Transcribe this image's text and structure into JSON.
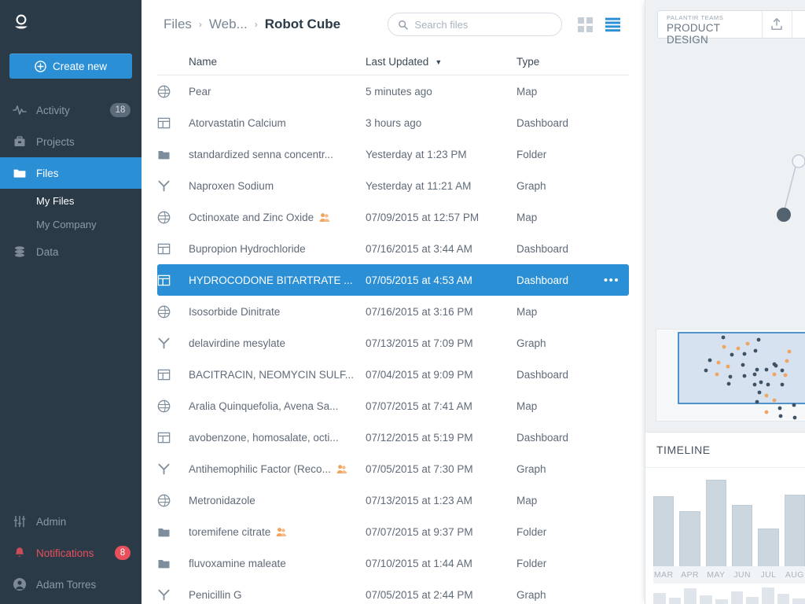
{
  "sidebar": {
    "logo_icon": "palantir-logo-icon",
    "create_button": {
      "label": "Create new",
      "icon": "plus-circle-icon"
    },
    "items": [
      {
        "label": "Activity",
        "icon": "activity-pulse-icon",
        "badge": "18",
        "active": false
      },
      {
        "label": "Projects",
        "icon": "briefcase-icon",
        "badge": "",
        "active": false
      },
      {
        "label": "Files",
        "icon": "folder-icon",
        "badge": "",
        "active": true
      }
    ],
    "sub_items": [
      {
        "label": "My Files",
        "current": true
      },
      {
        "label": "My Company",
        "current": false
      }
    ],
    "data_item": {
      "label": "Data",
      "icon": "database-icon"
    },
    "bottom_items": [
      {
        "label": "Admin",
        "icon": "sliders-icon",
        "badge": "",
        "alert": false
      },
      {
        "label": "Notifications",
        "icon": "bell-icon",
        "badge": "8",
        "alert": true
      },
      {
        "label": "Adam Torres",
        "icon": "user-avatar-icon",
        "badge": "",
        "alert": false
      }
    ],
    "colors": {
      "background": "#2b3a47",
      "accent": "#2a8fd4",
      "alert": "#e8505b"
    }
  },
  "header": {
    "breadcrumbs": [
      {
        "label": "Files",
        "current": false
      },
      {
        "label": "Web...",
        "current": false
      },
      {
        "label": "Robot Cube",
        "current": true
      }
    ],
    "separator": "›",
    "search": {
      "placeholder": "Search files",
      "value": "",
      "icon": "search-icon"
    },
    "view_grid": {
      "icon": "grid-view-icon",
      "active": false
    },
    "view_list": {
      "icon": "list-view-icon",
      "active": true
    }
  },
  "table": {
    "columns": {
      "name": "Name",
      "last_updated": "Last Updated",
      "type": "Type"
    },
    "sort": {
      "column": "Last Updated",
      "caret": "▼"
    },
    "more_label": "•••",
    "rows": [
      {
        "icon": "map-globe-icon",
        "name": "Pear",
        "updated": "5 minutes ago",
        "type": "Map",
        "shared": false,
        "selected": false
      },
      {
        "icon": "dashboard-icon",
        "name": "Atorvastatin Calcium",
        "updated": "3 hours ago",
        "type": "Dashboard",
        "shared": false,
        "selected": false
      },
      {
        "icon": "folder-file-icon",
        "name": "standardized senna concentr...",
        "updated": "Yesterday at 1:23 PM",
        "type": "Folder",
        "shared": false,
        "selected": false
      },
      {
        "icon": "graph-icon",
        "name": "Naproxen Sodium",
        "updated": "Yesterday at 11:21 AM",
        "type": "Graph",
        "shared": false,
        "selected": false
      },
      {
        "icon": "map-globe-icon",
        "name": "Octinoxate and Zinc Oxide",
        "updated": "07/09/2015 at 12:57 PM",
        "type": "Map",
        "shared": true,
        "selected": false
      },
      {
        "icon": "dashboard-icon",
        "name": "Bupropion Hydrochloride",
        "updated": "07/16/2015 at 3:44 AM",
        "type": "Dashboard",
        "shared": false,
        "selected": false
      },
      {
        "icon": "dashboard-icon",
        "name": "HYDROCODONE BITARTRATE ...",
        "updated": "07/05/2015 at 4:53 AM",
        "type": "Dashboard",
        "shared": false,
        "selected": true
      },
      {
        "icon": "map-globe-icon",
        "name": "Isosorbide Dinitrate",
        "updated": "07/16/2015 at 3:16 PM",
        "type": "Map",
        "shared": false,
        "selected": false
      },
      {
        "icon": "graph-icon",
        "name": "delavirdine mesylate",
        "updated": "07/13/2015 at 7:09 PM",
        "type": "Graph",
        "shared": false,
        "selected": false
      },
      {
        "icon": "dashboard-icon",
        "name": "BACITRACIN, NEOMYCIN SULF...",
        "updated": "07/04/2015 at 9:09 PM",
        "type": "Dashboard",
        "shared": false,
        "selected": false
      },
      {
        "icon": "map-globe-icon",
        "name": "Aralia Quinquefolia, Avena Sa...",
        "updated": "07/07/2015 at 7:41 AM",
        "type": "Map",
        "shared": false,
        "selected": false
      },
      {
        "icon": "dashboard-icon",
        "name": "avobenzone, homosalate, octi...",
        "updated": "07/12/2015 at 5:19 PM",
        "type": "Dashboard",
        "shared": false,
        "selected": false
      },
      {
        "icon": "graph-icon",
        "name": "Antihemophilic Factor (Reco...",
        "updated": "07/05/2015 at 7:30 PM",
        "type": "Graph",
        "shared": true,
        "selected": false
      },
      {
        "icon": "map-globe-icon",
        "name": "Metronidazole",
        "updated": "07/13/2015 at 1:23 AM",
        "type": "Map",
        "shared": false,
        "selected": false
      },
      {
        "icon": "folder-file-icon",
        "name": "toremifene citrate",
        "updated": "07/07/2015 at 9:37 PM",
        "type": "Folder",
        "shared": true,
        "selected": false
      },
      {
        "icon": "folder-file-icon",
        "name": "fluvoxamine maleate",
        "updated": "07/10/2015 at 1:44 AM",
        "type": "Folder",
        "shared": false,
        "selected": false
      },
      {
        "icon": "graph-icon",
        "name": "Penicillin G",
        "updated": "07/05/2015 at 2:44 PM",
        "type": "Graph",
        "shared": false,
        "selected": false
      }
    ]
  },
  "right_panel": {
    "brand_line1": "PALANTIR TEAMS",
    "brand_line2": "PRODUCT DESIGN",
    "upload_icon": "upload-icon",
    "share_icon": "share-icon",
    "timeline_title": "TIMELINE"
  },
  "chart_data": {
    "type": "bar",
    "title": "TIMELINE",
    "categories": [
      "MAR",
      "APR",
      "MAY",
      "JUN",
      "JUL",
      "AUG"
    ],
    "values": [
      66,
      52,
      82,
      58,
      36,
      68
    ],
    "xlabel": "",
    "ylabel": "",
    "ylim": [
      0,
      100
    ],
    "grid": false,
    "legend": "none",
    "bar_color": "#ccd6de"
  }
}
